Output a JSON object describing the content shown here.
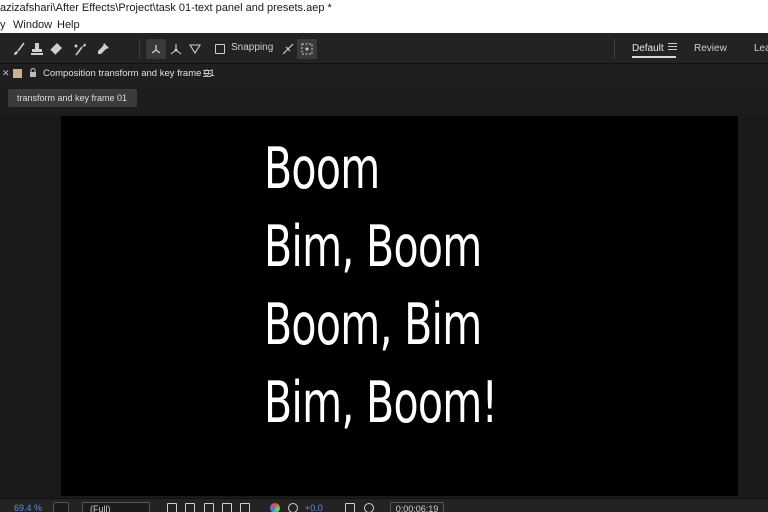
{
  "window": {
    "title": "azizafshari\\After Effects\\Project\\task 01-text panel and presets.aep *"
  },
  "menubar": {
    "items": [
      "y",
      "Window",
      "Help"
    ]
  },
  "toolbar": {
    "snapping_label": "Snapping",
    "snapping_checked": false
  },
  "workspaces": {
    "items": [
      "Default",
      "Review",
      "Lea"
    ],
    "active": "Default"
  },
  "composition_panel": {
    "title": "Composition transform and key frame 01",
    "label_color": "#c9b38c",
    "breadcrumb": "transform and key frame 01"
  },
  "composition": {
    "background": "#000000",
    "text_color": "#ffffff",
    "lines": [
      "Boom",
      "Bim, Boom",
      "Boom, Bim",
      "Bim, Boom!"
    ]
  },
  "viewer_controls": {
    "zoom": "69.4 %",
    "resolution": "(Full)",
    "exposure": "+0.0",
    "timecode": "0;00;06;19"
  }
}
